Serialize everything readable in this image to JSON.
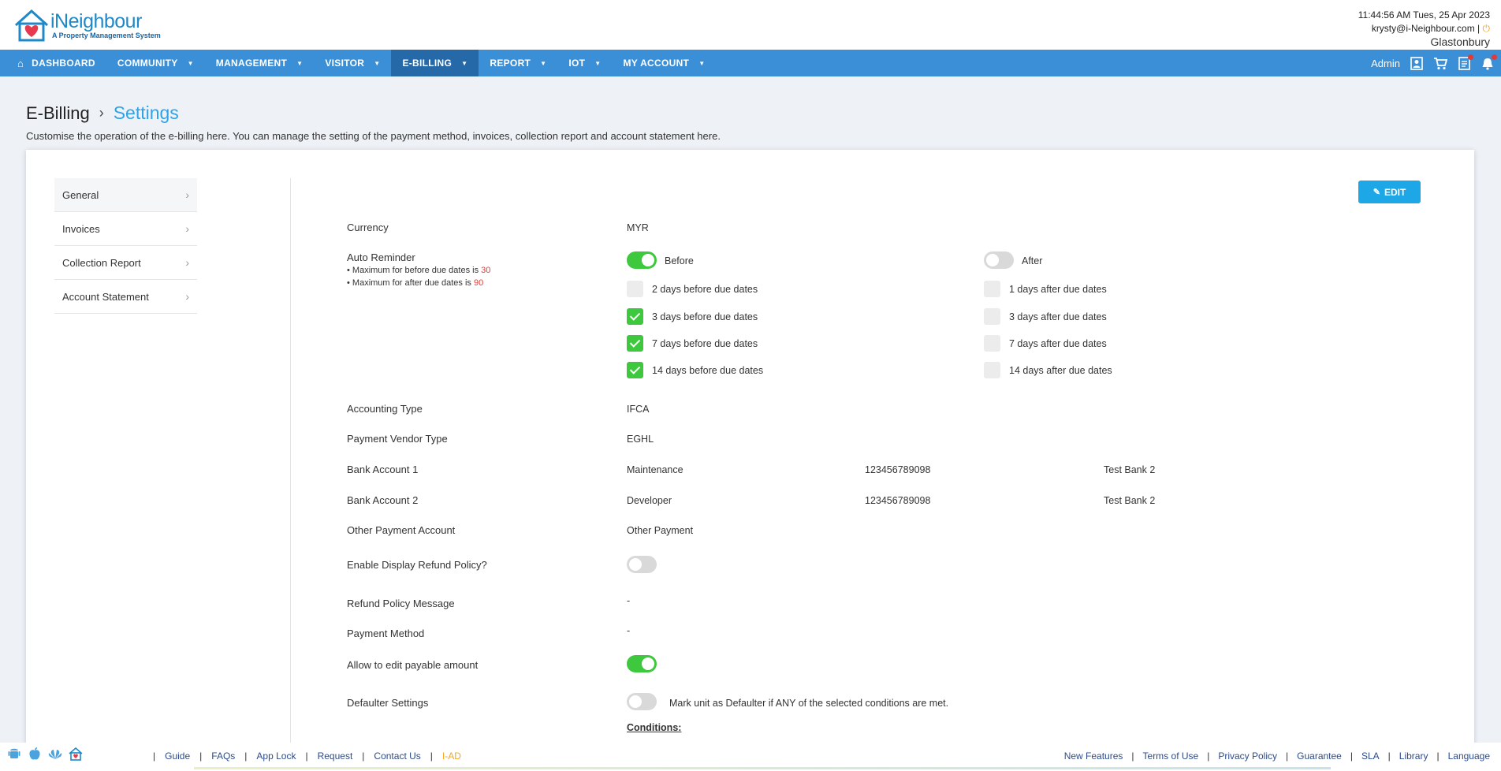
{
  "header": {
    "logo_name": "iNeighbour",
    "logo_tagline": "A Property Management System",
    "datetime": "11:44:56 AM  Tues, 25 Apr 2023",
    "email": "krysty@i-Neighbour.com |",
    "location": "Glastonbury"
  },
  "nav": {
    "items": [
      "DASHBOARD",
      "COMMUNITY",
      "MANAGEMENT",
      "VISITOR",
      "E-BILLING",
      "REPORT",
      "IOT",
      "MY ACCOUNT"
    ],
    "active": "E-BILLING",
    "user_role": "Admin"
  },
  "page": {
    "breadcrumb_root": "E-Billing",
    "breadcrumb_current": "Settings",
    "subtitle": "Customise the operation of the e-billing here. You can manage the setting of the payment method, invoices, collection report and account statement here."
  },
  "sidebar": {
    "items": [
      "General",
      "Invoices",
      "Collection Report",
      "Account Statement"
    ]
  },
  "edit_label": "EDIT",
  "settings": {
    "currency_label": "Currency",
    "currency_value": "MYR",
    "auto_reminder_label": "Auto Reminder",
    "note_before_prefix": "• Maximum for before due dates is ",
    "note_before_value": "30",
    "note_after_prefix": "• Maximum for after due dates is ",
    "note_after_value": "90",
    "before_label": "Before",
    "after_label": "After",
    "before_toggle_on": true,
    "after_toggle_on": false,
    "before_options": [
      {
        "label": "2 days before due dates",
        "checked": false
      },
      {
        "label": "3 days before due dates",
        "checked": true
      },
      {
        "label": "7 days before due dates",
        "checked": true
      },
      {
        "label": "14 days before due dates",
        "checked": true
      }
    ],
    "after_options": [
      {
        "label": "1 days after due dates",
        "checked": false
      },
      {
        "label": "3 days after due dates",
        "checked": false
      },
      {
        "label": "7 days after due dates",
        "checked": false
      },
      {
        "label": "14 days after due dates",
        "checked": false
      }
    ],
    "accounting_type_label": "Accounting Type",
    "accounting_type_value": "IFCA",
    "payment_vendor_label": "Payment Vendor Type",
    "payment_vendor_value": "EGHL",
    "bank1": {
      "label": "Bank Account 1",
      "name": "Maintenance",
      "number": "123456789098",
      "bank": "Test Bank 2"
    },
    "bank2": {
      "label": "Bank Account 2",
      "name": "Developer",
      "number": "123456789098",
      "bank": "Test Bank 2"
    },
    "other_payment_label": "Other Payment Account",
    "other_payment_value": "Other Payment",
    "refund_policy_label": "Enable Display Refund Policy?",
    "refund_policy_on": false,
    "refund_message_label": "Refund Policy Message",
    "refund_message_value": "-",
    "payment_method_label": "Payment Method",
    "payment_method_value": "-",
    "edit_payable_label": "Allow to edit payable amount",
    "edit_payable_on": true,
    "defaulter_label": "Defaulter Settings",
    "defaulter_on": false,
    "defaulter_text": "Mark unit as Defaulter if ANY of the selected conditions are met.",
    "conditions_label": "Conditions:"
  },
  "footer": {
    "links": [
      "Guide",
      "FAQs",
      "App Lock",
      "Request",
      "Contact Us",
      "I-AD"
    ],
    "right_links": [
      "New Features",
      "Terms of Use",
      "Privacy Policy",
      "Guarantee",
      "SLA",
      "Library",
      "Language"
    ]
  }
}
